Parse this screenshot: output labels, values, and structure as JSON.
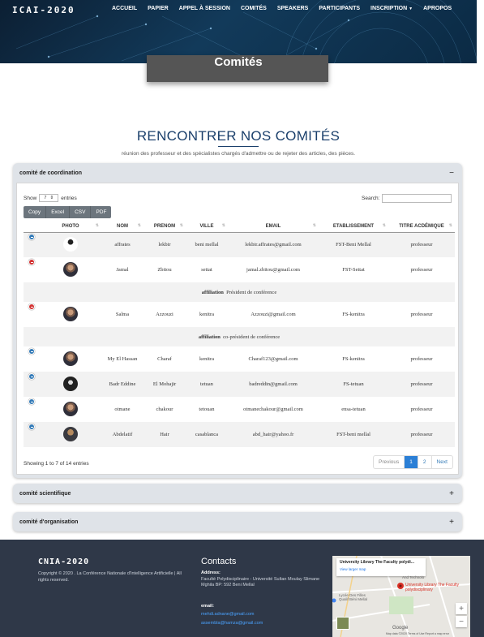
{
  "header": {
    "brand": "ICAI-2020",
    "nav": [
      {
        "label": "ACCUEIL"
      },
      {
        "label": "PAPIER"
      },
      {
        "label": "APPEL À SESSION"
      },
      {
        "label": "COMITÉS"
      },
      {
        "label": "SPEAKERS"
      },
      {
        "label": "PARTICIPANTS"
      },
      {
        "label": "INSCRIPTION",
        "dropdown": true
      },
      {
        "label": "APROPOS"
      }
    ],
    "page_title": "Comités"
  },
  "section": {
    "title": "RENCONTRER NOS COMITÉS",
    "subtitle": "réunion des professeur et des spécialistes chargés d'admettre ou de rejeter des articles, des pièces."
  },
  "accordions": [
    {
      "title": "comité de coordination",
      "expanded": true,
      "toggle": "−"
    },
    {
      "title": "comité scientifique",
      "expanded": false,
      "toggle": "+"
    },
    {
      "title": "comité d'organisation",
      "expanded": false,
      "toggle": "+"
    }
  ],
  "table": {
    "show_label": "Show",
    "page_size": "7",
    "entries_label": "entries",
    "search_label": "Search:",
    "buttons": [
      "Copy",
      "Excel",
      "CSV",
      "PDF"
    ],
    "columns": [
      "PHOTO",
      "NOM",
      "PRENOM",
      "VILLE",
      "EMAIL",
      "ETABLISSEMENT",
      "TITRE ACDÉMIQUE"
    ],
    "rows": [
      {
        "nom": "affrates",
        "prenom": "lekbir",
        "ville": "beni mellal",
        "email": "lekbir.affrates@gmail.com",
        "etab": "FST-Beni Mellal",
        "titre": "professeur",
        "expanded": false
      },
      {
        "nom": "Jamal",
        "prenom": "Zbitou",
        "ville": "settat",
        "email": "jamal.zbitou@gmail.com",
        "etab": "FST-Settat",
        "titre": "professeur",
        "expanded": true,
        "child_label": "affiliation",
        "child_value": "Président de conférence"
      },
      {
        "nom": "Salma",
        "prenom": "Azzouzi",
        "ville": "kenitra",
        "email": "Azzouzi@gmail.com",
        "etab": "FS-kenitra",
        "titre": "professeur",
        "expanded": true,
        "child_label": "affiliation",
        "child_value": "co-président de conférence"
      },
      {
        "nom": "My El Hassan",
        "prenom": "Charaf",
        "ville": "kenitra",
        "email": "Charaf123@gmail.com",
        "etab": "FS-kenitra",
        "titre": "professeur",
        "expanded": false
      },
      {
        "nom": "Badr Eddine",
        "prenom": "El Mohajir",
        "ville": "tetuan",
        "email": "badreddin@gmail.com",
        "etab": "FS-tetuan",
        "titre": "professeur",
        "expanded": false
      },
      {
        "nom": "otmane",
        "prenom": "chakour",
        "ville": "tetouan",
        "email": "otmanechakour@gmail.com",
        "etab": "ensa-tetuan",
        "titre": "professeur",
        "expanded": false
      },
      {
        "nom": "Abdelatif",
        "prenom": "Hair",
        "ville": "casablanca",
        "email": "abd_hair@yahoo.fr",
        "etab": "FST-beni mellal",
        "titre": "professeur",
        "expanded": false
      }
    ],
    "info": "Showing 1 to 7 of 14 entries",
    "pager": {
      "previous": "Previous",
      "pages": [
        "1",
        "2"
      ],
      "next": "Next",
      "current": "1"
    }
  },
  "footer": {
    "brand": "CNIA-2020",
    "copyright": "Copyright ©  2020 . La Conférence Nationale d'Intelligence Artificielle | All rights reserved.",
    "contact_title": "Contacts",
    "address_label": "Address:",
    "address": "Faculté Polydisciplinaire - Université Sultan Moulay Slimane Mghila BP: 592 Beni Mellal",
    "email_label": "email:",
    "emails": [
      "mehdi.adnane@gmail.com",
      "assembla@hamza@gmail.com"
    ],
    "map": {
      "card_title": "University Library The Faculty polydi...",
      "card_link": "View larger map",
      "place": "University Library The Faculty polydisciplinary",
      "labels": [
        "Lycée Des Filles Qualif Béni Mellal",
        "And Technolo"
      ],
      "zoom_in": "+",
      "zoom_out": "−",
      "brand": "Google",
      "footer_text": "Map data ©2020   Terms of Use   Report a map error"
    }
  }
}
